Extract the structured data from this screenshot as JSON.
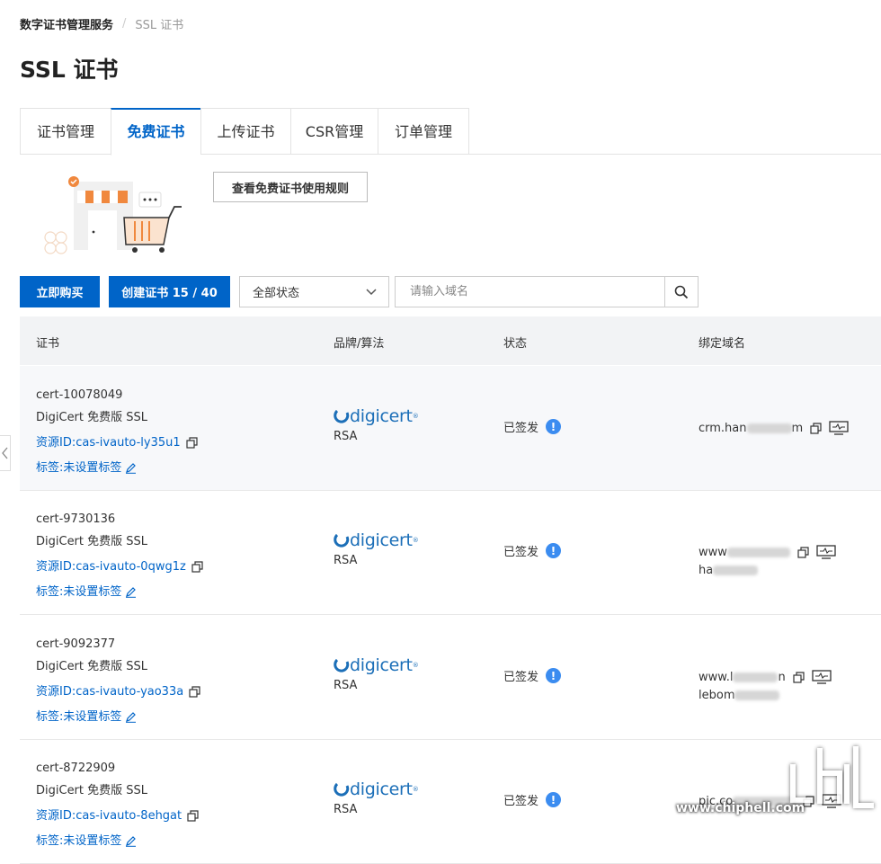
{
  "breadcrumb": {
    "service": "数字证书管理服务",
    "current": "SSL 证书"
  },
  "page_title": "SSL 证书",
  "tabs": [
    {
      "label": "证书管理",
      "active": false
    },
    {
      "label": "免费证书",
      "active": true
    },
    {
      "label": "上传证书",
      "active": false
    },
    {
      "label": "CSR管理",
      "active": false
    },
    {
      "label": "订单管理",
      "active": false
    }
  ],
  "rules_button": "查看免费证书使用规则",
  "toolbar": {
    "buy_label": "立即购买",
    "create_label": "创建证书 15 / 40",
    "status_filter": "全部状态",
    "search_placeholder": "请输入域名"
  },
  "table": {
    "headers": [
      "证书",
      "品牌/算法",
      "状态",
      "绑定域名"
    ],
    "rows": [
      {
        "name": "cert-10078049",
        "type": "DigiCert 免费版 SSL",
        "resource_id": "资源ID:cas-ivauto-ly35u1",
        "tag": "标签:未设置标签",
        "brand": "digicert",
        "algo": "RSA",
        "status": "已签发",
        "domain_line1": "crm.han",
        "domain_tail1": "m",
        "domain_line2": ""
      },
      {
        "name": "cert-9730136",
        "type": "DigiCert 免费版 SSL",
        "resource_id": "资源ID:cas-ivauto-0qwg1z",
        "tag": "标签:未设置标签",
        "brand": "digicert",
        "algo": "RSA",
        "status": "已签发",
        "domain_line1": "www",
        "domain_tail1": "",
        "domain_line2": "ha"
      },
      {
        "name": "cert-9092377",
        "type": "DigiCert 免费版 SSL",
        "resource_id": "资源ID:cas-ivauto-yao33a",
        "tag": "标签:未设置标签",
        "brand": "digicert",
        "algo": "RSA",
        "status": "已签发",
        "domain_line1": "www.l",
        "domain_tail1": "n",
        "domain_line2": "lebom"
      },
      {
        "name": "cert-8722909",
        "type": "DigiCert 免费版 SSL",
        "resource_id": "资源ID:cas-ivauto-8ehgat",
        "tag": "标签:未设置标签",
        "brand": "digicert",
        "algo": "RSA",
        "status": "已签发",
        "domain_line1": "pic.co",
        "domain_tail1": "",
        "domain_line2": ""
      }
    ]
  },
  "watermark": {
    "text": "www.chiphell.com"
  },
  "colors": {
    "primary": "#0064c8",
    "link": "#0064c8",
    "info": "#3b8cf0",
    "brand": "#1c6fb8"
  }
}
